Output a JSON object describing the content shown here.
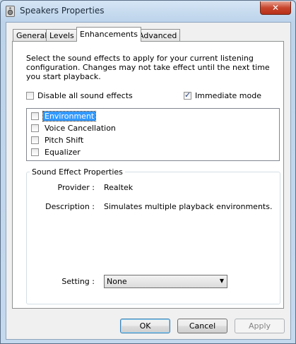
{
  "window": {
    "title": "Speakers Properties",
    "close_glyph": "✕"
  },
  "tabs": [
    {
      "label": "General"
    },
    {
      "label": "Levels"
    },
    {
      "label": "Enhancements"
    },
    {
      "label": "Advanced"
    }
  ],
  "enhancements": {
    "description": "Select the sound effects to apply for your current listening configuration. Changes may not take effect until the next time you start playback.",
    "disable_all": {
      "label": "Disable all sound effects",
      "checked": false
    },
    "immediate_mode": {
      "label": "Immediate mode",
      "checked": true
    },
    "effects": [
      {
        "label": "Environment",
        "checked": false,
        "selected": true
      },
      {
        "label": "Voice Cancellation",
        "checked": false,
        "selected": false
      },
      {
        "label": "Pitch Shift",
        "checked": false,
        "selected": false
      },
      {
        "label": "Equalizer",
        "checked": false,
        "selected": false
      }
    ],
    "properties": {
      "group_title": "Sound Effect Properties",
      "provider_label": "Provider :",
      "provider_value": "Realtek",
      "description_label": "Description :",
      "description_value": "Simulates multiple playback environments.",
      "setting_label": "Setting :",
      "setting_value": "None"
    }
  },
  "buttons": {
    "ok": "OK",
    "cancel": "Cancel",
    "apply": "Apply"
  }
}
